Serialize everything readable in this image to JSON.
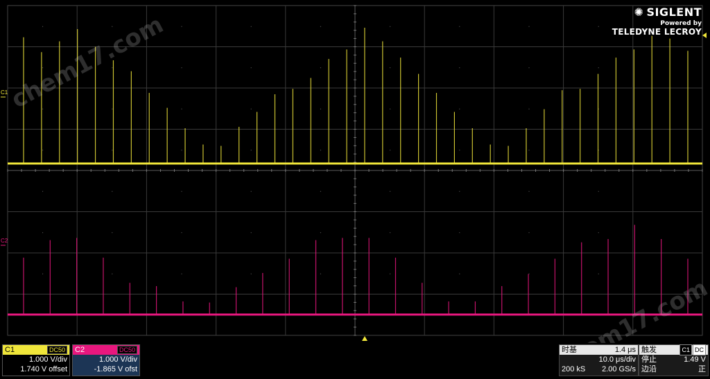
{
  "brand": {
    "name": "SIGLENT",
    "powered": "Powered by",
    "partner": "TELEDYNE LECROY"
  },
  "watermark": "chem17.com",
  "markers": {
    "c1": "C1",
    "c2": "C2"
  },
  "colors": {
    "c1": "#f0e63a",
    "c2": "#e8177e",
    "grid": "#3a3a3a",
    "gridDot": "#666666"
  },
  "channels": [
    {
      "label": "C1",
      "coupling": "DC50",
      "scale": "1.000 V/div",
      "offset": "1.740 V offset"
    },
    {
      "label": "C2",
      "coupling": "DC50",
      "scale": "1.000 V/div",
      "offset": "-1.865 V ofst"
    }
  ],
  "timebase": {
    "label": "时基",
    "delay": "1.4 μs",
    "scale": "10.0 μs/div",
    "points": "200 kS",
    "rate": "2.00 GS/s"
  },
  "trigger": {
    "label": "触发",
    "source": "C1",
    "coupling": "DC",
    "state": "停止",
    "level": "1.49 V",
    "edge_label": "边沿",
    "slope": "正"
  },
  "waveforms": {
    "c1_pulses": [
      0.93,
      0.82,
      0.9,
      0.99,
      0.86,
      0.76,
      0.68,
      0.52,
      0.41,
      0.26,
      0.14,
      0.13,
      0.27,
      0.38,
      0.51,
      0.55,
      0.63,
      0.77,
      0.84,
      1.0,
      0.9,
      0.78,
      0.66,
      0.52,
      0.38,
      0.26,
      0.14,
      0.13,
      0.26,
      0.4,
      0.54,
      0.55,
      0.66,
      0.78,
      0.84,
      0.94,
      0.92,
      0.83
    ],
    "c2_pulses": [
      0.52,
      0.68,
      0.7,
      0.52,
      0.29,
      0.26,
      0.12,
      0.11,
      0.25,
      0.38,
      0.51,
      0.68,
      0.7,
      0.7,
      0.52,
      0.29,
      0.12,
      0.12,
      0.26,
      0.37,
      0.51,
      0.66,
      0.69,
      0.82,
      0.69,
      0.51
    ]
  }
}
